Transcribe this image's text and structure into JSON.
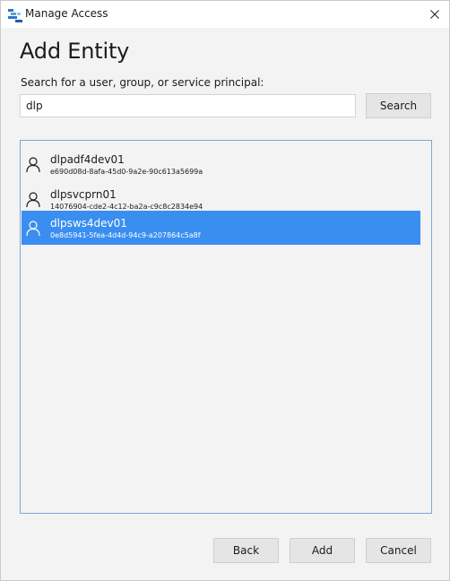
{
  "window": {
    "title": "Manage Access"
  },
  "heading": "Add Entity",
  "search": {
    "label": "Search for a user, group, or service principal:",
    "value": "dlp",
    "button_label": "Search"
  },
  "results": [
    {
      "name": "dlpadf4dev01",
      "id": "e690d08d-8afa-45d0-9a2e-90c613a5699a",
      "selected": false
    },
    {
      "name": "dlpsvcprn01",
      "id": "14076904-cde2-4c12-ba2a-c9c8c2834e94",
      "selected": false
    },
    {
      "name": "dlpsws4dev01",
      "id": "0e8d5941-5fea-4d4d-94c9-a207864c5a8f",
      "selected": true
    }
  ],
  "footer": {
    "back_label": "Back",
    "add_label": "Add",
    "cancel_label": "Cancel"
  },
  "colors": {
    "selection": "#3a8ef0",
    "list_border": "#7aa7d6",
    "background": "#f3f3f3"
  },
  "icons": [
    "app-icon",
    "close-icon",
    "user-icon"
  ]
}
